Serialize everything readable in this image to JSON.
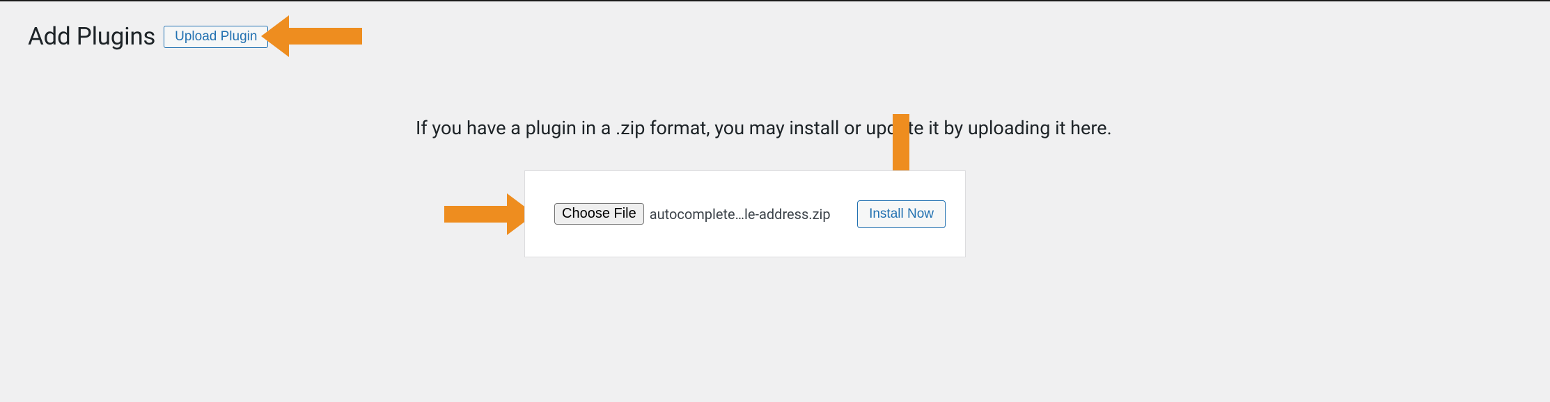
{
  "header": {
    "title": "Add Plugins",
    "upload_button": "Upload Plugin"
  },
  "instruction": "If you have a plugin in a .zip format, you may install or update it by uploading it here.",
  "upload_panel": {
    "choose_file_label": "Choose File",
    "filename": "autocomplete…le-address.zip",
    "install_button": "Install Now"
  },
  "annotations": {
    "arrow_color": "#ee8d1f"
  }
}
